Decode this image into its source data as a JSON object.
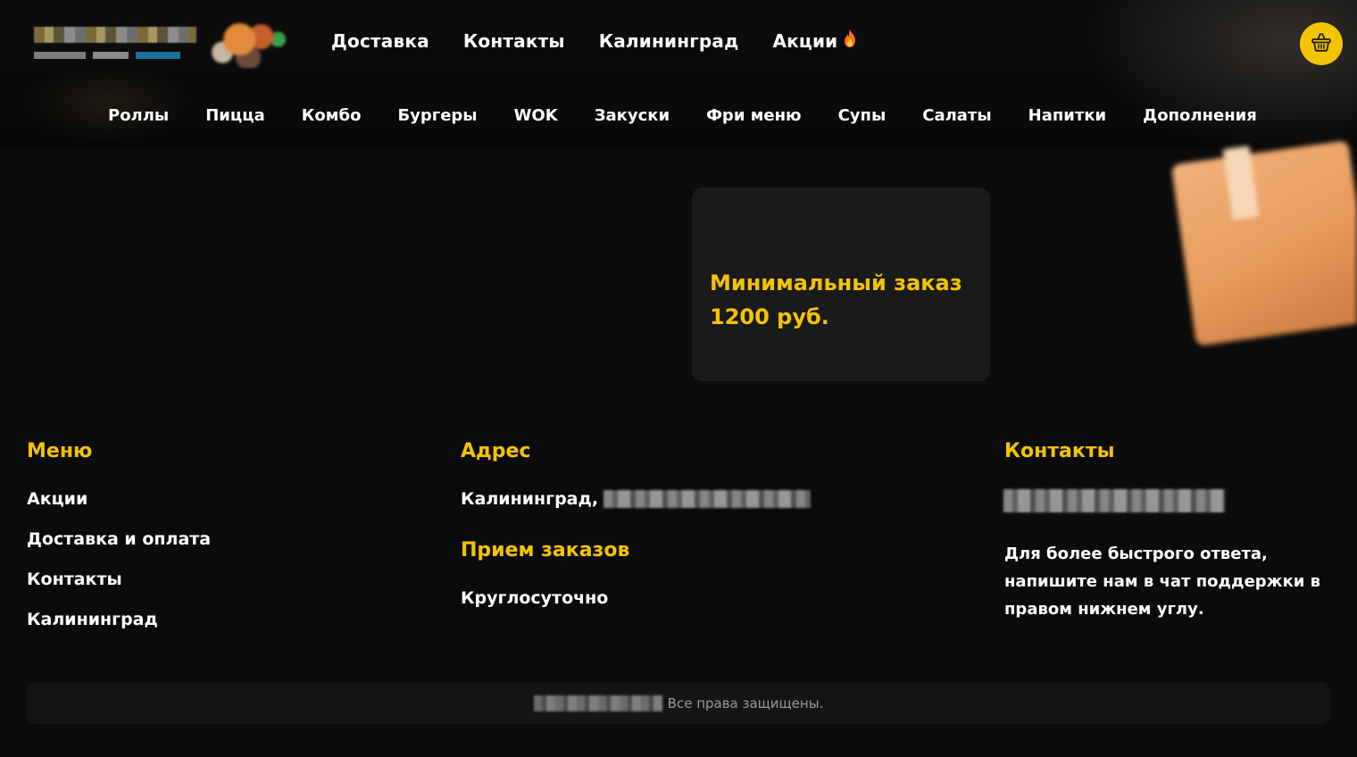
{
  "header": {
    "nav": [
      {
        "label": "Доставка"
      },
      {
        "label": "Контакты"
      },
      {
        "label": "Калининград"
      },
      {
        "label": "Акции",
        "icon": "fire-icon"
      }
    ],
    "categories": [
      {
        "label": "Роллы"
      },
      {
        "label": "Пицца"
      },
      {
        "label": "Комбо"
      },
      {
        "label": "Бургеры"
      },
      {
        "label": "WOK"
      },
      {
        "label": "Закуски"
      },
      {
        "label": "Фри меню"
      },
      {
        "label": "Супы"
      },
      {
        "label": "Салаты"
      },
      {
        "label": "Напитки"
      },
      {
        "label": "Дополнения"
      }
    ],
    "cart_icon": "basket-icon"
  },
  "info_card": {
    "line1": "Минимальный заказ",
    "line2": "1200 руб."
  },
  "footer": {
    "menu": {
      "title": "Меню",
      "links": [
        "Акции",
        "Доставка и оплата",
        "Контакты",
        "Калининград"
      ]
    },
    "address": {
      "title": "Адрес",
      "city": "Калининград,",
      "orders_title": "Прием заказов",
      "orders_value": "Круглосуточно"
    },
    "contacts": {
      "title": "Контакты",
      "note": "Для более быстрого ответа, напишите нам в чат поддержки в правом нижнем углу."
    },
    "copyright": "Все права защищены."
  },
  "colors": {
    "accent": "#f4c400",
    "background": "#0b0b0b",
    "card": "#1a1a1a"
  }
}
